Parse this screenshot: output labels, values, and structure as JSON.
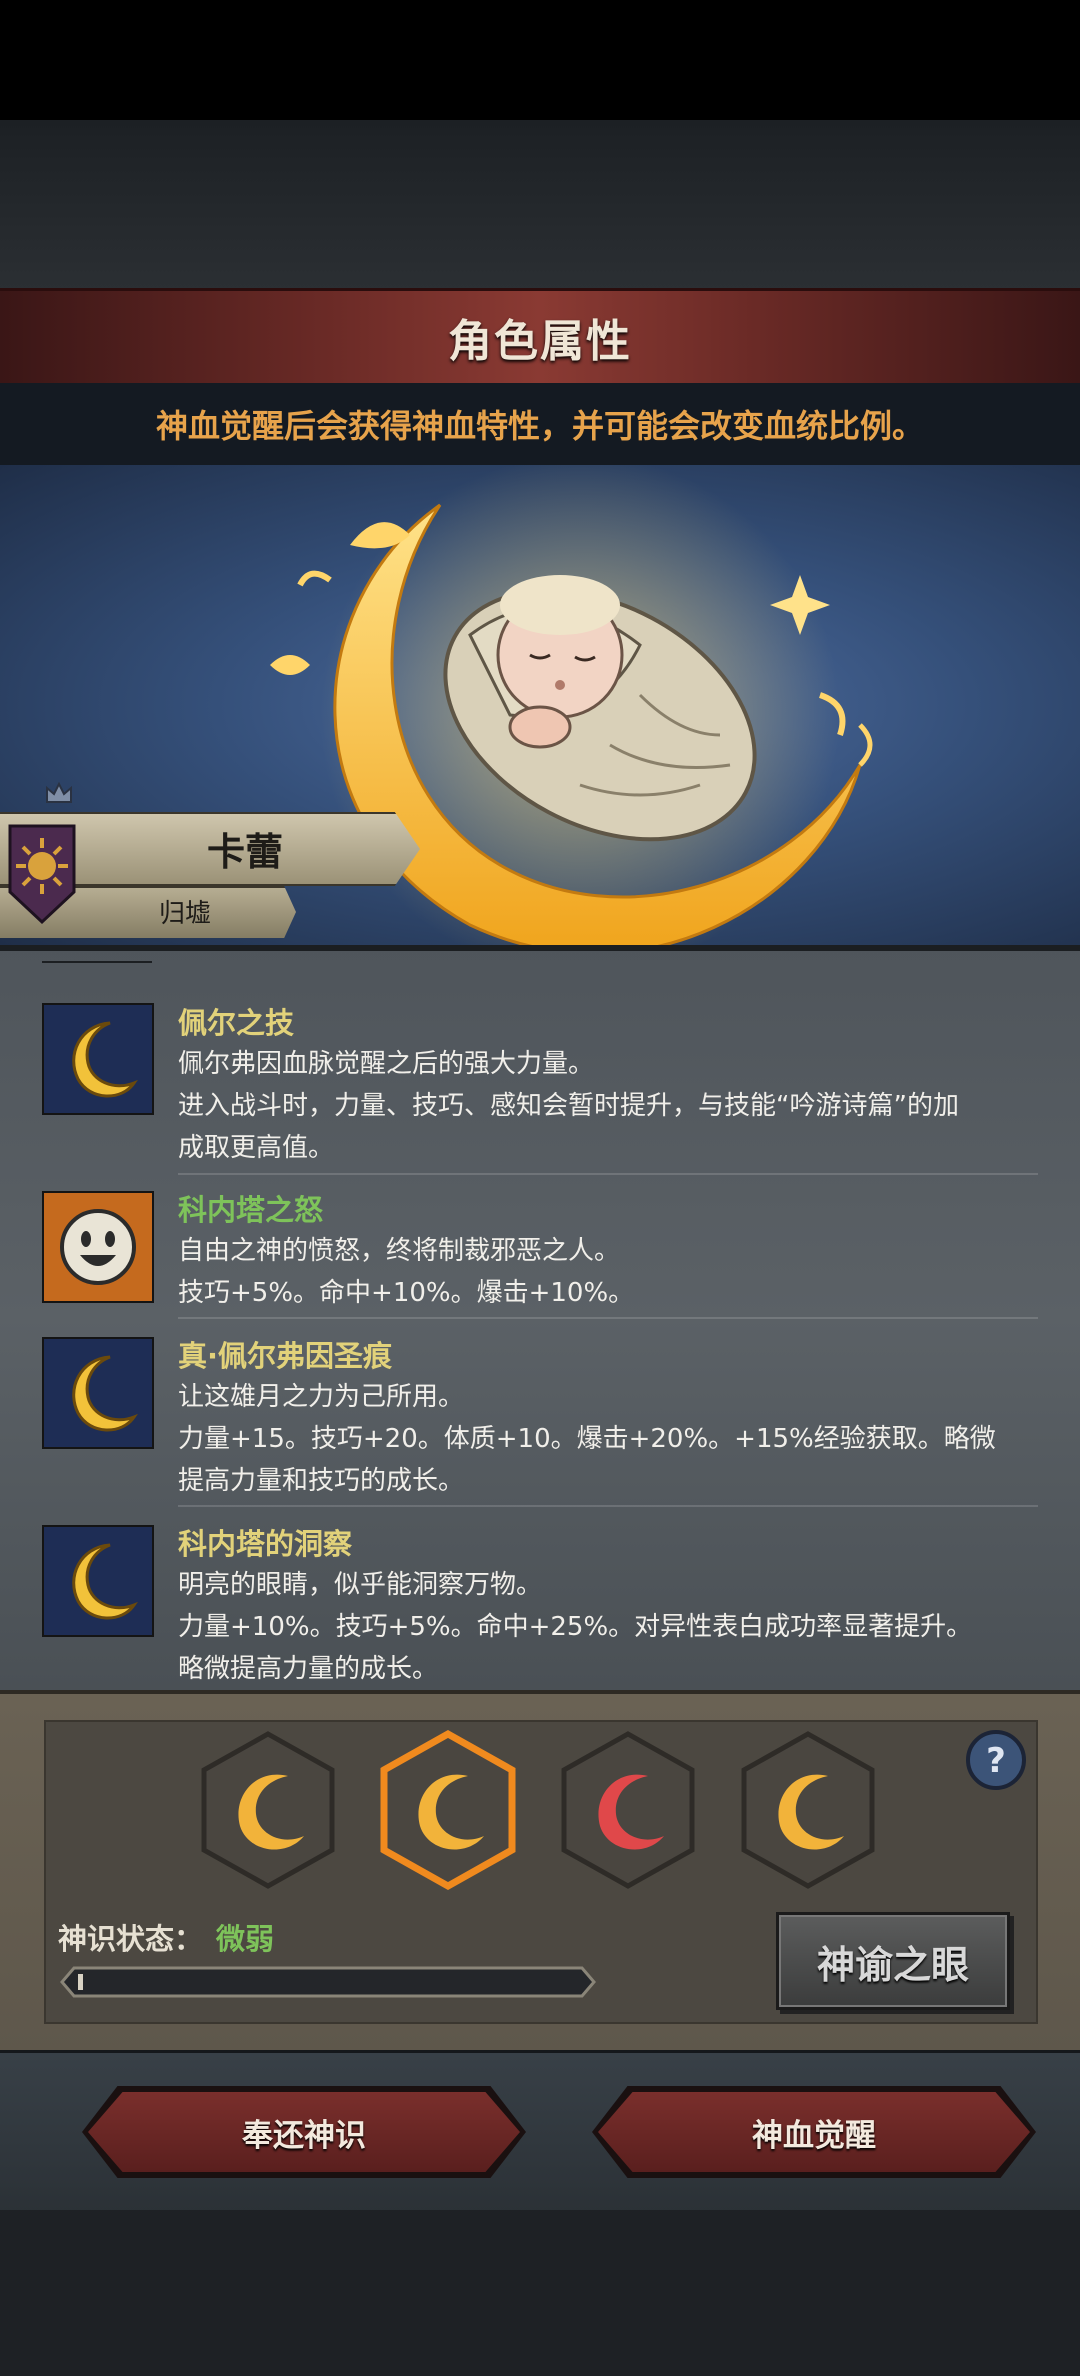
{
  "header": {
    "title": "角色属性",
    "subtitle": "神血觉醒后会获得神血特性，并可能会改变血统比例。"
  },
  "character": {
    "name": "卡蕾",
    "origin": "归墟",
    "crest_icon": "sun-crest-icon",
    "rank_icon": "crown-icon"
  },
  "traits": [
    {
      "name": "佩尔之技",
      "name_color": "#e2d27a",
      "icon": "crescent-moon-icon",
      "lines": [
        "佩尔弗因血脉觉醒之后的强大力量。",
        "进入战斗时，力量、技巧、感知会暂时提升，与技能“吟游诗篇”的加",
        "成取更高值。"
      ]
    },
    {
      "name": "科内塔之怒",
      "name_color": "#7ec35a",
      "icon": "smiley-face-icon",
      "lines": [
        "自由之神的愤怒，终将制裁邪恶之人。",
        "技巧+5%。命中+10%。爆击+10%。"
      ]
    },
    {
      "name": "真·佩尔弗因圣痕",
      "name_color": "#e2d27a",
      "icon": "crescent-moon-icon",
      "lines": [
        "让这雄月之力为己所用。",
        "力量+15。技巧+20。体质+10。爆击+20%。+15%经验获取。略微",
        "提高力量和技巧的成长。"
      ]
    },
    {
      "name": "科内塔的洞察",
      "name_color": "#e2d27a",
      "icon": "crescent-moon-icon",
      "lines": [
        "明亮的眼睛，似乎能洞察万物。",
        "力量+10%。技巧+5%。命中+25%。对异性表白成功率显著提升。",
        "略微提高力量的成长。"
      ]
    }
  ],
  "awakening": {
    "slots": [
      {
        "icon": "gold-crescent-icon",
        "color": "#f2b33a",
        "selected": false
      },
      {
        "icon": "gold-crescent-icon",
        "color": "#f2b33a",
        "selected": true
      },
      {
        "icon": "red-crescent-icon",
        "color": "#e0484a",
        "selected": false
      },
      {
        "icon": "gold-crescent-icon",
        "color": "#f2b33a",
        "selected": false
      }
    ],
    "help_icon": "question-mark-icon",
    "state_label": "神识状态：",
    "state_value": "微弱",
    "progress": 0.01,
    "oracle_button": "神谕之眼"
  },
  "footer": {
    "return_button": "奉还神识",
    "awaken_button": "神血觉醒"
  }
}
